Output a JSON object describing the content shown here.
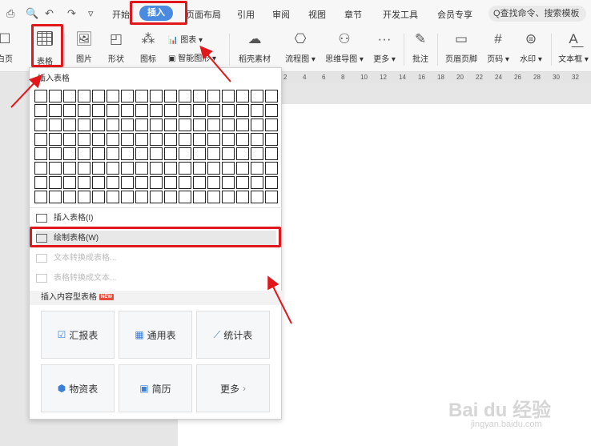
{
  "toolbar": {
    "quick_access": [
      "⎙",
      "🔍",
      "↶",
      "↷",
      "▿"
    ],
    "tabs": [
      "开始",
      "插入",
      "页面布局",
      "引用",
      "审阅",
      "视图",
      "章节",
      "开发工具",
      "会员专享"
    ],
    "search_text": "Q查找命令、搜索模板"
  },
  "ribbon": {
    "blank_page": "白页",
    "table": "表格",
    "picture": "图片",
    "shape": "形状",
    "icon": "图标",
    "chart": "图表",
    "smart_shape": "智能图形",
    "shell_material": "稻壳素材",
    "flowchart": "流程图",
    "mindmap": "思维导图",
    "more": "更多",
    "comment": "批注",
    "header_footer": "页眉页脚",
    "page_number": "页码",
    "watermark": "水印",
    "textbox": "文本框"
  },
  "ruler": [
    "2",
    "4",
    "6",
    "8",
    "10",
    "12",
    "14",
    "16",
    "18",
    "20",
    "22",
    "24",
    "26",
    "28",
    "30",
    "32"
  ],
  "dropdown": {
    "title": "插入表格",
    "grid_rows": 8,
    "grid_cols": 17,
    "menu": [
      {
        "label": "插入表格(I)",
        "enabled": true
      },
      {
        "label": "绘制表格(W)",
        "enabled": true
      },
      {
        "label": "文本转换成表格...",
        "enabled": false
      },
      {
        "label": "表格转换成文本...",
        "enabled": false
      }
    ],
    "section_title": "插入内容型表格",
    "section_badge": "NEW",
    "cards": [
      {
        "label": "汇报表",
        "icon": "report-icon"
      },
      {
        "label": "通用表",
        "icon": "grid-icon"
      },
      {
        "label": "统计表",
        "icon": "chart-line-icon"
      },
      {
        "label": "物资表",
        "icon": "box-icon"
      },
      {
        "label": "简历",
        "icon": "resume-icon"
      },
      {
        "label": "更多",
        "icon": "chevron-right-icon"
      }
    ]
  },
  "watermark": {
    "text": "Bai du 经验",
    "url": "jingyan.baidu.com"
  },
  "colors": {
    "accent": "#4a8be0",
    "annotation_red": "#e0181b",
    "card_icon": "#3b7fd9"
  }
}
